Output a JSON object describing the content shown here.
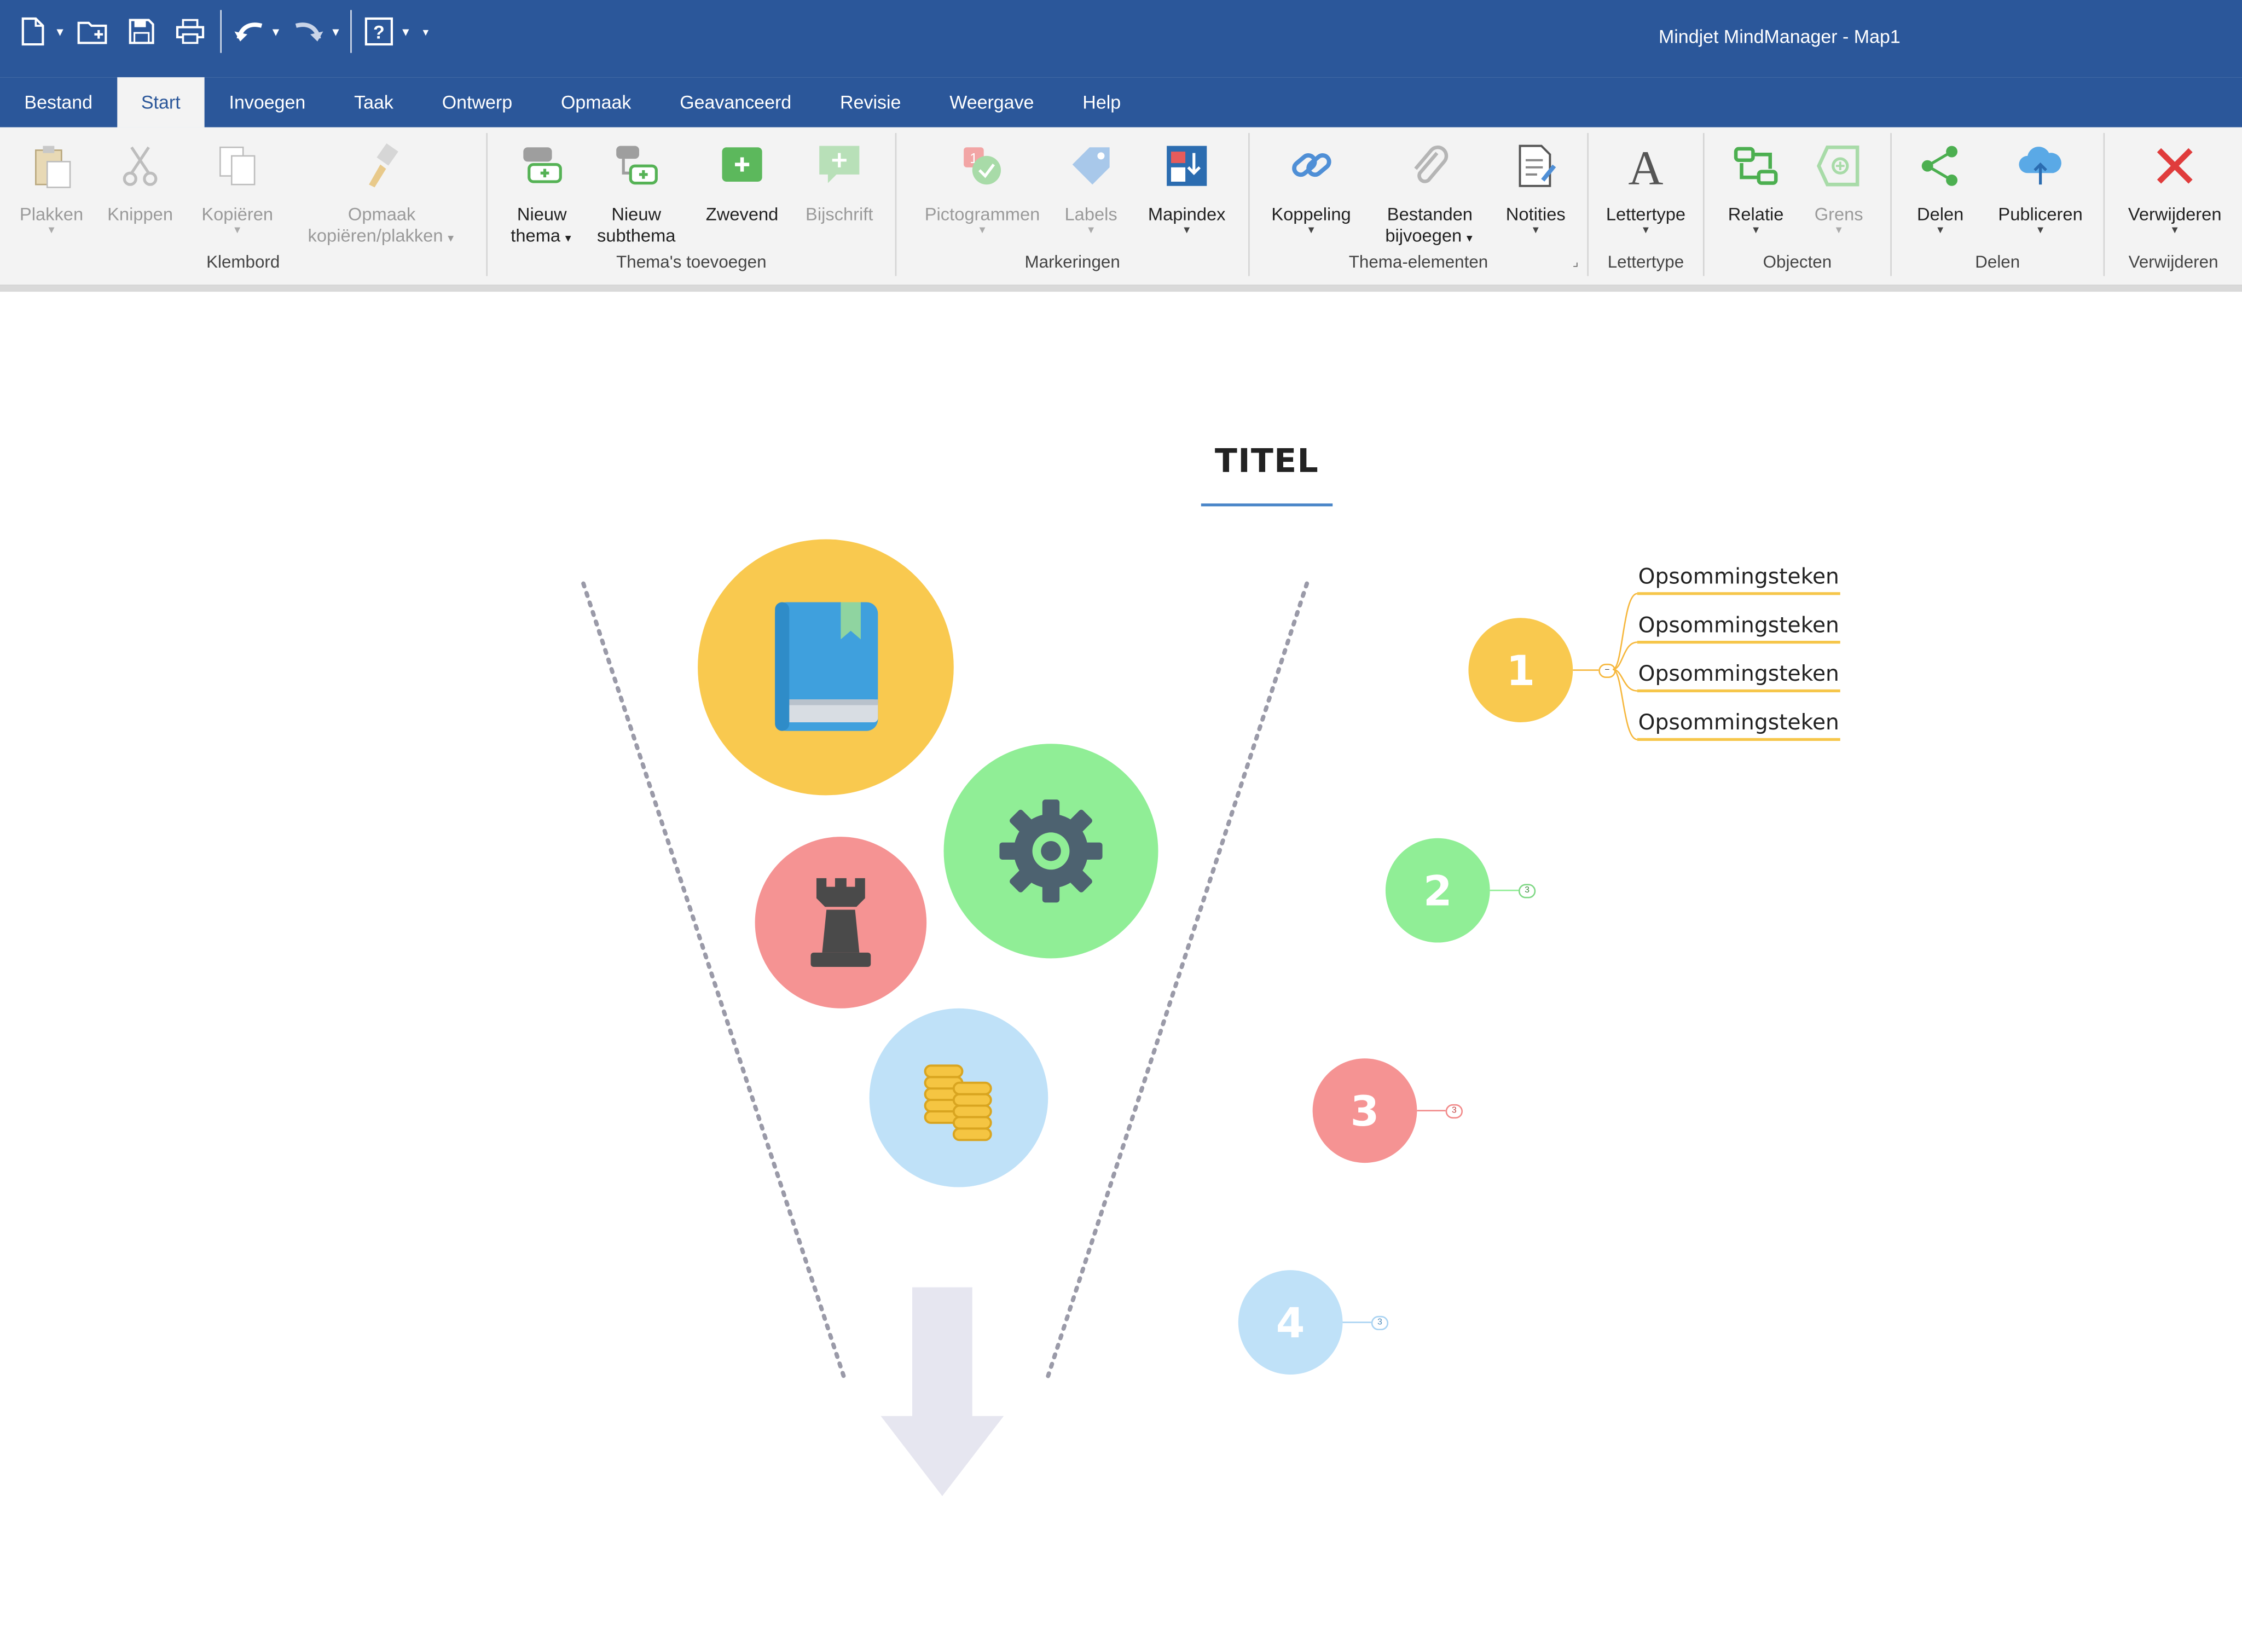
{
  "window": {
    "title": "Mindjet MindManager - Map1"
  },
  "quick_access": [
    {
      "name": "new-document-icon"
    },
    {
      "name": "open-folder-icon"
    },
    {
      "name": "save-icon"
    },
    {
      "name": "print-icon"
    },
    {
      "name": "undo-icon"
    },
    {
      "name": "redo-icon"
    },
    {
      "name": "help-icon"
    },
    {
      "name": "customize-dropdown-icon"
    }
  ],
  "tabs": [
    "Bestand",
    "Start",
    "Invoegen",
    "Taak",
    "Ontwerp",
    "Opmaak",
    "Geavanceerd",
    "Revisie",
    "Weergave",
    "Help"
  ],
  "active_tab": "Start",
  "ribbon": {
    "groups": {
      "klembord": "Klembord",
      "themas": "Thema's toevoegen",
      "markeringen": "Markeringen",
      "thema_elementen": "Thema-elementen",
      "lettertype": "Lettertype",
      "objecten": "Objecten",
      "delen": "Delen",
      "verwijderen": "Verwijderen"
    },
    "buttons": {
      "plakken": "Plakken",
      "knippen": "Knippen",
      "kopieren": "Kopiëren",
      "opmaak_1": "Opmaak",
      "opmaak_2": "kopiëren/plakken",
      "nieuw_thema_1": "Nieuw",
      "nieuw_thema_2": "thema",
      "nieuw_subthema_1": "Nieuw",
      "nieuw_subthema_2": "subthema",
      "zwevend": "Zwevend",
      "bijschrift": "Bijschrift",
      "pictogrammen": "Pictogrammen",
      "labels": "Labels",
      "mapindex": "Mapindex",
      "koppeling": "Koppeling",
      "bestanden_1": "Bestanden",
      "bestanden_2": "bijvoegen",
      "notities": "Notities",
      "lettertype": "Lettertype",
      "relatie": "Relatie",
      "grens": "Grens",
      "delen": "Delen",
      "publiceren": "Publiceren",
      "verwijderen": "Verwijderen"
    }
  },
  "map": {
    "title": "TITEL",
    "topics": [
      {
        "number": "1",
        "color": "#f9c94f"
      },
      {
        "number": "2",
        "color": "#90ee96"
      },
      {
        "number": "3",
        "color": "#f59393"
      },
      {
        "number": "4",
        "color": "#bfe1f8"
      }
    ],
    "collapsed_counts": {
      "t2": "3",
      "t3": "3",
      "t4": "3"
    },
    "bullets": [
      "Opsommingsteken",
      "Opsommingsteken",
      "Opsommingsteken",
      "Opsommingsteken"
    ],
    "icons": [
      "book-icon",
      "gear-icon",
      "chess-rook-icon",
      "coins-icon"
    ]
  },
  "colors": {
    "accent": "#2b579a",
    "funnel_arrow": "#e6e6f0"
  }
}
